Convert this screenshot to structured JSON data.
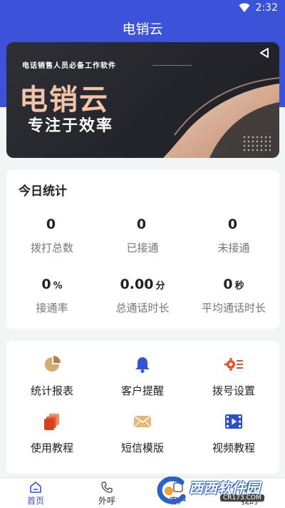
{
  "status_bar": {
    "time": "2:32"
  },
  "app_bar": {
    "title": "电销云"
  },
  "banner": {
    "subtitle": "电话销售人员必备工作软件",
    "title": "电销云",
    "slogan": "专注于效率"
  },
  "stats": {
    "title": "今日统计",
    "items": [
      {
        "value": "0",
        "unit": "",
        "label": "拨打总数"
      },
      {
        "value": "0",
        "unit": "",
        "label": "已接通"
      },
      {
        "value": "0",
        "unit": "",
        "label": "未接通"
      },
      {
        "value": "0",
        "unit": "%",
        "label": "接通率"
      },
      {
        "value": "0.00",
        "unit": "分",
        "label": "总通话时长"
      },
      {
        "value": "0",
        "unit": "秒",
        "label": "平均通话时长"
      }
    ]
  },
  "menu": {
    "items": [
      {
        "label": "统计报表",
        "icon": "pie-chart-icon"
      },
      {
        "label": "客户提醒",
        "icon": "bell-icon"
      },
      {
        "label": "拨号设置",
        "icon": "settings-list-icon"
      },
      {
        "label": "使用教程",
        "icon": "stacked-pages-icon"
      },
      {
        "label": "短信模版",
        "icon": "envelope-icon"
      },
      {
        "label": "视频教程",
        "icon": "video-film-icon"
      }
    ]
  },
  "tabs": [
    {
      "label": "首页",
      "icon": "home-icon",
      "active": true
    },
    {
      "label": "外呼",
      "icon": "phone-icon",
      "active": false
    },
    {
      "label": "客户",
      "icon": "customer-icon",
      "active": false
    },
    {
      "label": "我的",
      "icon": "profile-icon",
      "active": false
    }
  ],
  "watermark": {
    "text": "西西软件园",
    "url": "CR173.COM"
  },
  "colors": {
    "primary": "#3b52d9",
    "banner_gold": "#f1c3a8",
    "menu_orange": "#e0562a",
    "menu_blue": "#3454d1"
  }
}
